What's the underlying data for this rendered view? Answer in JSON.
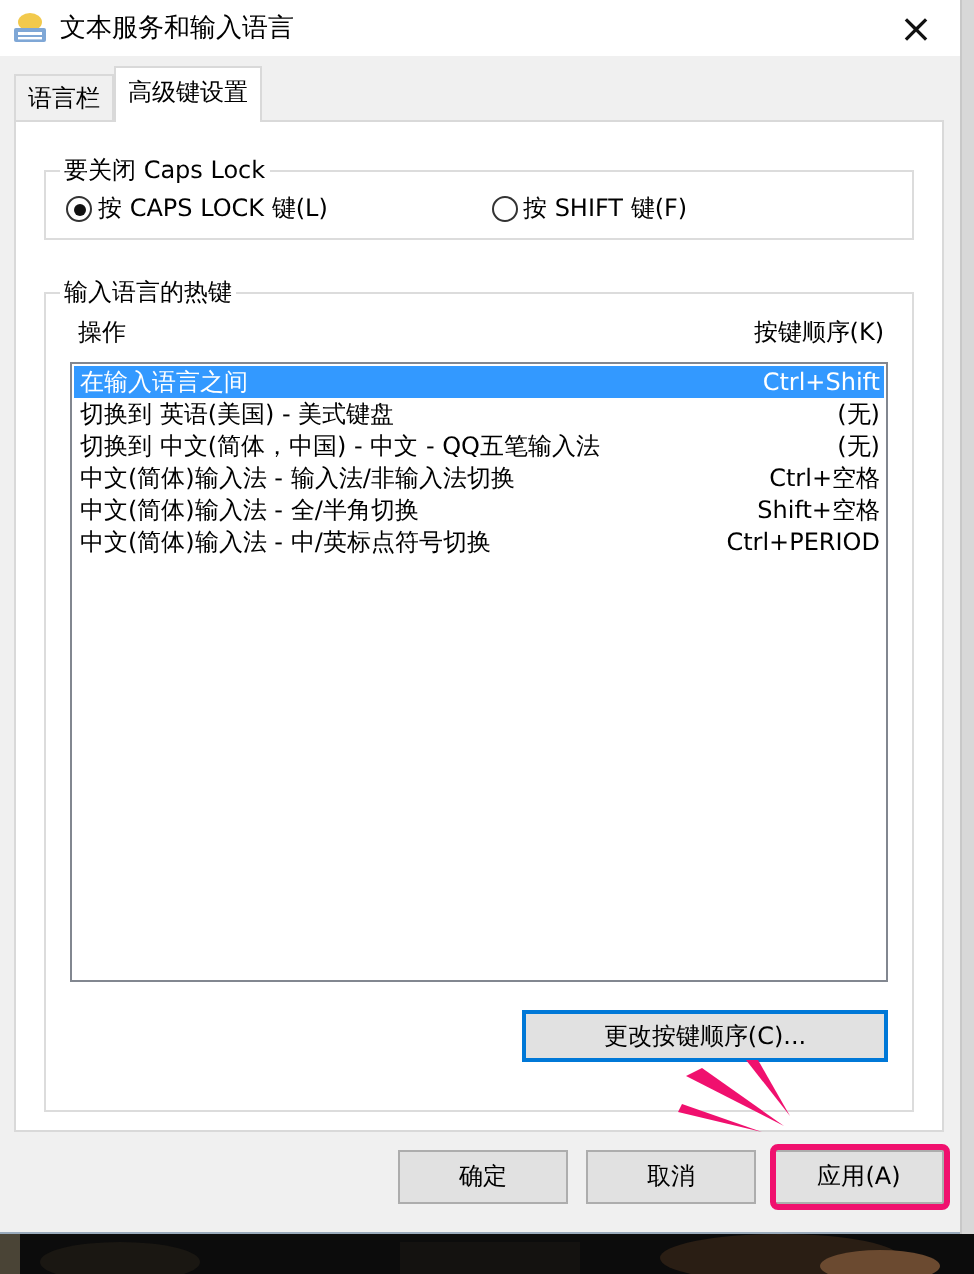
{
  "window": {
    "title": "文本服务和输入语言",
    "close": "×"
  },
  "tabs": [
    {
      "label": "语言栏",
      "selected": false
    },
    {
      "label": "高级键设置",
      "selected": true
    }
  ],
  "caps_lock": {
    "title": "要关闭 Caps Lock",
    "options": [
      {
        "label": "按 CAPS LOCK 键(L)",
        "selected": true
      },
      {
        "label": "按 SHIFT 键(F)",
        "selected": false
      }
    ]
  },
  "hotkeys": {
    "title": "输入语言的热键",
    "columns": [
      "操作",
      "按键顺序(K)"
    ],
    "rows": [
      {
        "action": "在输入语言之间",
        "keys": "Ctrl+Shift",
        "selected": true
      },
      {
        "action": "切换到 英语(美国) - 美式键盘",
        "keys": "(无)",
        "selected": false
      },
      {
        "action": "切换到 中文(简体，中国) - 中文 - QQ五笔输入法",
        "keys": "(无)",
        "selected": false
      },
      {
        "action": "中文(简体)输入法 - 输入法/非输入法切换",
        "keys": "Ctrl+空格",
        "selected": false
      },
      {
        "action": "中文(简体)输入法 - 全/半角切换",
        "keys": "Shift+空格",
        "selected": false
      },
      {
        "action": "中文(简体)输入法 - 中/英标点符号切换",
        "keys": "Ctrl+PERIOD",
        "selected": false
      }
    ],
    "change_button": {
      "label": "更改按键顺序(C)...",
      "focused": true
    }
  },
  "buttons": [
    {
      "label": "确定",
      "highlighted": false
    },
    {
      "label": "取消",
      "highlighted": false
    },
    {
      "label": "应用(A)",
      "highlighted": true
    }
  ]
}
